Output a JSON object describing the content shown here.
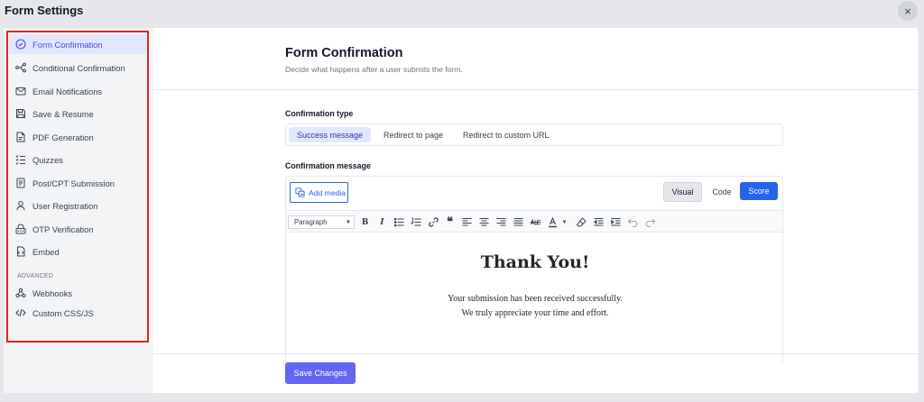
{
  "window": {
    "title": "Form Settings",
    "close_label": "×"
  },
  "sidebar": {
    "items": [
      {
        "label": "Form Confirmation",
        "icon": "check-circle-icon",
        "active": true
      },
      {
        "label": "Conditional Confirmation",
        "icon": "branch-icon"
      },
      {
        "label": "Email Notifications",
        "icon": "mail-icon"
      },
      {
        "label": "Save & Resume",
        "icon": "save-icon"
      },
      {
        "label": "PDF Generation",
        "icon": "pdf-icon"
      },
      {
        "label": "Quizzes",
        "icon": "checklist-icon"
      },
      {
        "label": "Post/CPT Submission",
        "icon": "document-icon"
      },
      {
        "label": "User Registration",
        "icon": "user-icon"
      },
      {
        "label": "OTP Verification",
        "icon": "otp-icon"
      },
      {
        "label": "Embed",
        "icon": "embed-icon"
      }
    ],
    "advanced_heading": "ADVANCED",
    "advanced_items": [
      {
        "label": "Webhooks",
        "icon": "webhook-icon"
      },
      {
        "label": "Custom CSS/JS",
        "icon": "code-icon"
      }
    ]
  },
  "main": {
    "title": "Form Confirmation",
    "subtitle": "Decide what happens after a user submits the form.",
    "confirmation_type_label": "Confirmation type",
    "confirmation_types": [
      "Success message",
      "Redirect to page",
      "Redirect to custom URL"
    ],
    "confirmation_message_label": "Confirmation message"
  },
  "editor": {
    "add_media_label": "Add media",
    "tabs": {
      "visual": "Visual",
      "code": "Code",
      "score": "Score"
    },
    "paragraph_select": "Paragraph",
    "content": {
      "heading": "Thank You!",
      "line1": "Your submission has been received successfully.",
      "line2": "We truly appreciate your time and effort."
    }
  },
  "footer": {
    "save_label": "Save Changes"
  },
  "colors": {
    "accent": "#6366f1",
    "active_bg": "#e0e7ff",
    "score_button": "#2563eb",
    "highlight_border": "#dc2626"
  }
}
